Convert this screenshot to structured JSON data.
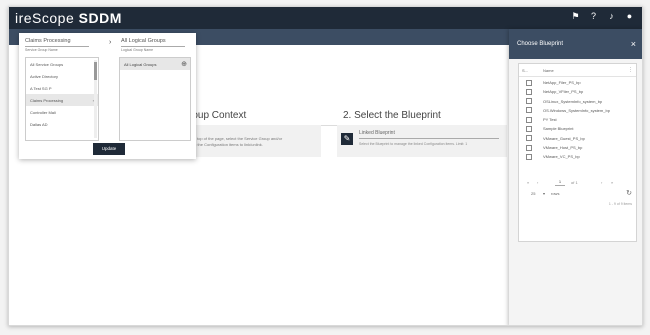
{
  "app": {
    "brand_prefix": "ireScope",
    "brand_suffix": "SDDM"
  },
  "top_icons": [
    "flag-icon",
    "help-icon",
    "bell-icon",
    "user-icon"
  ],
  "steps": {
    "step1_title": "roup Context",
    "step1_text1": "et",
    "step1_text2": "e the top of the page, select the Service Group and/or",
    "step1_text3": "ssing the Configuration items to link/unlink.",
    "step2_title": "2. Select the Blueprint",
    "linked_label": "Linked Blueprint",
    "linked_hint": "Select the Blueprint to manage the linked Configuration items. Limit: 1"
  },
  "dropdown": {
    "service_group_value": "Claims Processing",
    "service_group_caption": "Service Group Name",
    "logical_group_value": "All Logical Groups",
    "logical_group_caption": "Logical Group Name",
    "service_groups": [
      "All Service Groups",
      "Active Directory",
      "A Test SG P",
      "Claims Processing",
      "Controller Mali",
      "Dallas AD"
    ],
    "selected_index": 3,
    "logical_groups": [
      "All Logical Groups"
    ],
    "update_label": "Update"
  },
  "panel": {
    "title": "Choose Blueprint",
    "col_s": "S...",
    "col_name": "Name",
    "rows": [
      "NetApp_Filer_PS_bp",
      "NetApp_VFiler_PS_bp",
      "OSLinux_SystemInfo_system_bp",
      "OS.Windows_SystemInfo_system_bp",
      "PY Test",
      "Sample Blueprint",
      "VMware_Guest_PS_bp",
      "VMware_Host_PS_bp",
      "VMware_VC_PS_bp"
    ],
    "pager": {
      "first": "«",
      "prev": "‹",
      "current": "1",
      "of": "of 1",
      "next": "›",
      "last": "»"
    },
    "rows_per_page": "25",
    "rows_label": "rows",
    "summary": "1 - 9 of 9 items"
  }
}
